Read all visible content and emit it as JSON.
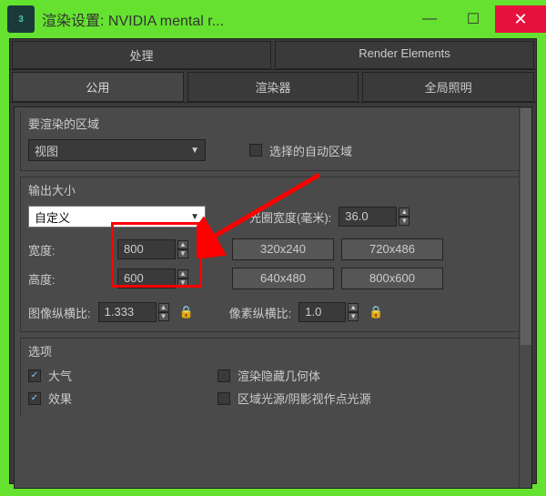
{
  "window": {
    "title": "渲染设置: NVIDIA mental r...",
    "app_icon_text": "3"
  },
  "tabs_row1": [
    {
      "label": "处理"
    },
    {
      "label": "Render Elements"
    }
  ],
  "tabs_row2": [
    {
      "label": "公用",
      "active": true
    },
    {
      "label": "渲染器"
    },
    {
      "label": "全局照明"
    }
  ],
  "render_area": {
    "title": "要渲染的区域",
    "dropdown": "视图",
    "auto_region_label": "选择的自动区域"
  },
  "output_size": {
    "title": "输出大小",
    "dropdown": "自定义",
    "aperture_label": "光圈宽度(毫米):",
    "aperture_value": "36.0",
    "width_label": "宽度:",
    "width_value": "800",
    "height_label": "高度:",
    "height_value": "600",
    "presets": [
      "320x240",
      "720x486",
      "640x480",
      "800x600"
    ],
    "image_aspect_label": "图像纵横比:",
    "image_aspect_value": "1.333",
    "pixel_aspect_label": "像素纵横比:",
    "pixel_aspect_value": "1.0"
  },
  "options": {
    "title": "选项",
    "atmosphere": "大气",
    "effects": "效果",
    "render_hidden": "渲染隐藏几何体",
    "area_lights": "区域光源/阴影视作点光源"
  }
}
